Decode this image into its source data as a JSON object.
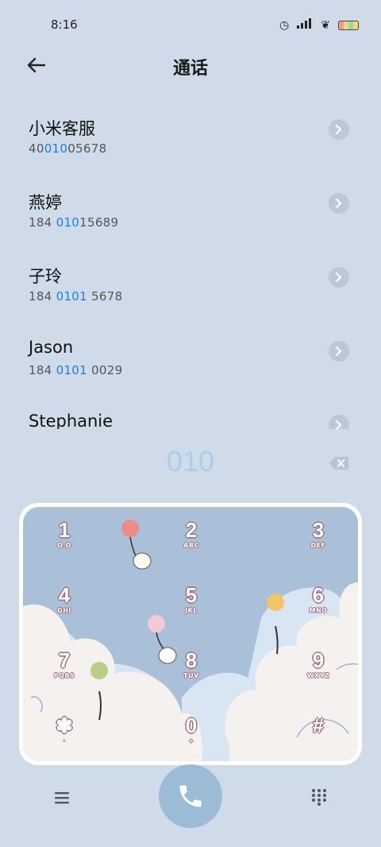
{
  "status_bar": {
    "time": "8:16"
  },
  "header": {
    "title": "通话"
  },
  "contacts": [
    {
      "name": "小米客服",
      "num_pre": "40",
      "num_hl": "010",
      "num_post": "05678"
    },
    {
      "name": "燕婷",
      "num_pre": "184 ",
      "num_hl": "010",
      "num_post": "15689"
    },
    {
      "name": "子玲",
      "num_pre": "184 ",
      "num_hl": "0101",
      "num_post": " 5678"
    },
    {
      "name": "Jason",
      "num_pre": "184 ",
      "num_hl": "0101",
      "num_post": " 0029"
    },
    {
      "name": "Stephanie",
      "num_pre": "",
      "num_hl": "",
      "num_post": ""
    }
  ],
  "dialed": "010",
  "keys": [
    {
      "num": "1",
      "letters": "O.O"
    },
    {
      "num": "2",
      "letters": "ABC"
    },
    {
      "num": "3",
      "letters": "DEF"
    },
    {
      "num": "4",
      "letters": "GHI"
    },
    {
      "num": "5",
      "letters": "JKL"
    },
    {
      "num": "6",
      "letters": "MNO"
    },
    {
      "num": "7",
      "letters": "PQRS"
    },
    {
      "num": "8",
      "letters": "TUV"
    },
    {
      "num": "9",
      "letters": "WXYZ"
    },
    {
      "num": "✽",
      "letters": "·"
    },
    {
      "num": "0",
      "letters": "+"
    },
    {
      "num": "#",
      "letters": ""
    }
  ],
  "colors": {
    "background": "#cfdbe8",
    "highlight": "#1e7de0",
    "call_button": "#9cbbd6",
    "dialed_text": "#a8cfea"
  }
}
